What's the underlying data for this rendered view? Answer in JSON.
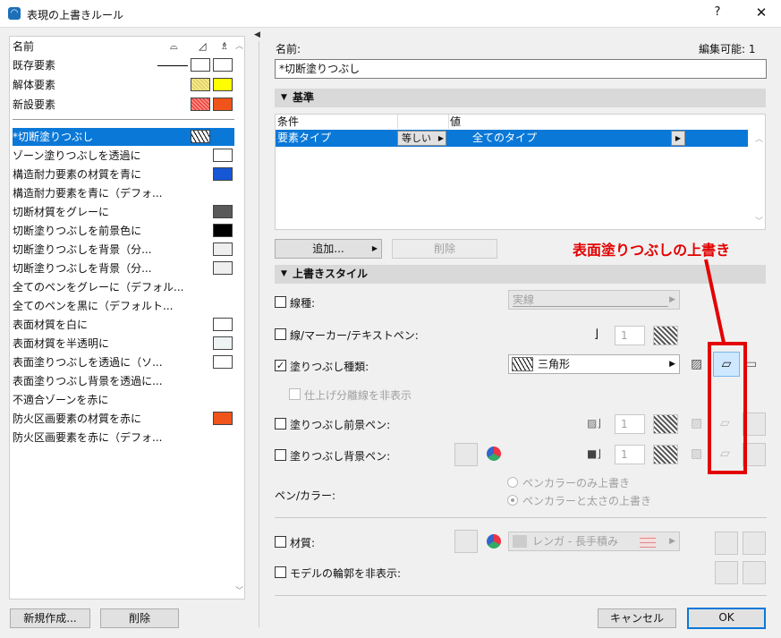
{
  "window": {
    "title": "表現の上書きルール",
    "help": "?",
    "close": "✕"
  },
  "left": {
    "header": {
      "name": "名前"
    },
    "basic_rows": [
      {
        "label": "既存要素",
        "swatch1": "#ffffff",
        "swatch2": "#ffffff",
        "line": true
      },
      {
        "label": "解体要素",
        "swatch1": "#f5ea8a",
        "swatch2": "#ffff00"
      },
      {
        "label": "新設要素",
        "swatch1": "#ff8a80",
        "swatch2": "#f0541a"
      }
    ],
    "rules": [
      {
        "label": "*切断塗りつぶし",
        "swatch": "pattern",
        "selected": true
      },
      {
        "label": "ゾーン塗りつぶしを透過に",
        "swatch": "#ffffff"
      },
      {
        "label": "構造耐力要素の材質を青に",
        "swatch": "#1657d6"
      },
      {
        "label": "構造耐力要素を青に（デフォ...",
        "swatch": ""
      },
      {
        "label": "切断材質をグレーに",
        "swatch": "#595959"
      },
      {
        "label": "切断塗りつぶしを前景色に",
        "swatch": "#000000"
      },
      {
        "label": "切断塗りつぶしを背景（分...",
        "swatch": "#eeeeee"
      },
      {
        "label": "切断塗りつぶしを背景（分...",
        "swatch": "#eeeeee"
      },
      {
        "label": "全てのペンをグレーに（デフォル...",
        "swatch": ""
      },
      {
        "label": "全てのペンを黒に（デフォルト...",
        "swatch": ""
      },
      {
        "label": "表面材質を白に",
        "swatch": "#ffffff"
      },
      {
        "label": "表面材質を半透明に",
        "swatch": "#eef4f4"
      },
      {
        "label": "表面塗りつぶしを透過に（ソ...",
        "swatch": "#ffffff"
      },
      {
        "label": "表面塗りつぶし背景を透過に...",
        "swatch": ""
      },
      {
        "label": "不適合ゾーンを赤に",
        "swatch": ""
      },
      {
        "label": "防火区画要素の材質を赤に",
        "swatch": "#f0541a"
      },
      {
        "label": "防火区画要素を赤に（デフォ...",
        "swatch": ""
      }
    ],
    "new_button": "新規作成...",
    "delete_button": "削除"
  },
  "right": {
    "name_label": "名前:",
    "editable": "編集可能: 1",
    "name_value": "*切断塗りつぶし",
    "criteria": {
      "title": "基準",
      "col_condition": "条件",
      "col_value": "値",
      "row": {
        "condition": "要素タイプ",
        "operator": "等しい",
        "value": "全てのタイプ"
      },
      "add_button": "追加...",
      "delete_button": "削除"
    },
    "style": {
      "title": "上書きスタイル",
      "line_type": {
        "label": "線種:",
        "value": "実線"
      },
      "line_pen": {
        "label": "線/マーカー/テキストペン:",
        "pen": "1"
      },
      "fill_type": {
        "label": "塗りつぶし種類:",
        "value": "三角形"
      },
      "hide_finish": "仕上げ分離線を非表示",
      "fill_fg_pen": {
        "label": "塗りつぶし前景ペン:",
        "pen": "1"
      },
      "fill_bg_pen": {
        "label": "塗りつぶし背景ペン:",
        "pen": "1"
      },
      "pen_color": {
        "label": "ペン/カラー:",
        "option1": "ペンカラーのみ上書き",
        "option2": "ペンカラーと太さの上書き"
      },
      "material": {
        "label": "材質:",
        "value": "レンガ - 長手積み"
      },
      "hide_contour": "モデルの輪郭を非表示:"
    },
    "annotation": "表面塗りつぶしの上書き",
    "cancel_button": "キャンセル",
    "ok_button": "OK"
  }
}
